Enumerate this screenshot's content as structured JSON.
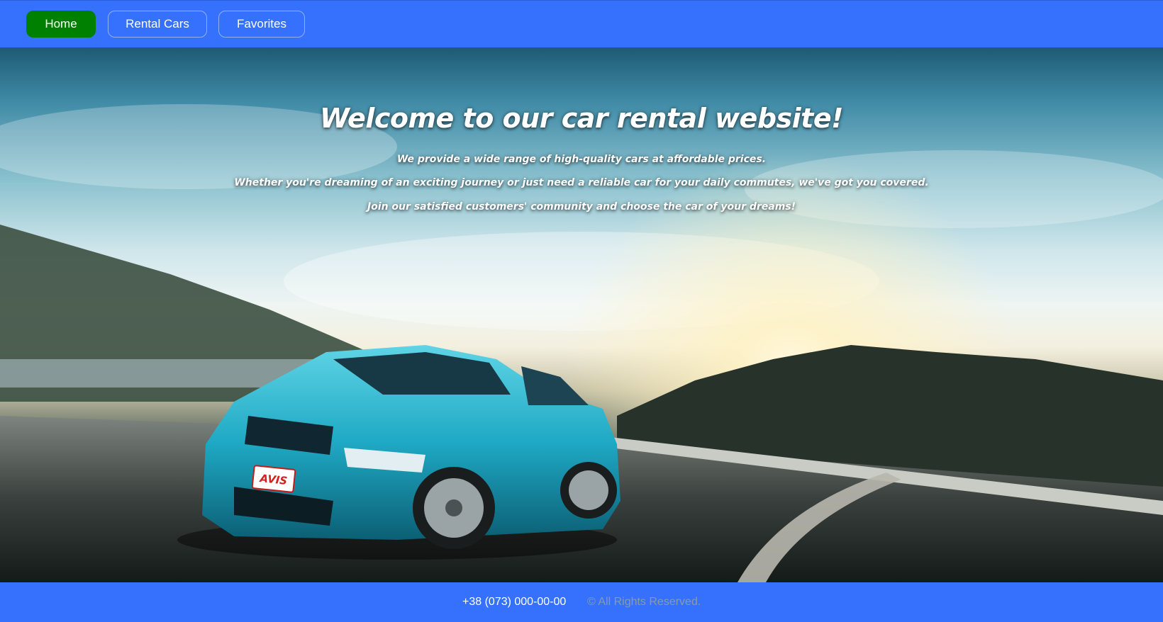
{
  "nav": {
    "items": [
      {
        "label": "Home",
        "active": true
      },
      {
        "label": "Rental Cars",
        "active": false
      },
      {
        "label": "Favorites",
        "active": false
      }
    ]
  },
  "hero": {
    "title": "Welcome to our car rental website!",
    "lines": [
      "We provide a wide range of high-quality cars at affordable prices.",
      "Whether you're dreaming of an exciting journey or just need a reliable car for your daily commutes, we've got you covered.",
      "Join our satisfied customers' community and choose the car of your dreams!"
    ],
    "plate_text": "AVIS"
  },
  "footer": {
    "phone": "+38 (073) 000-00-00",
    "copyright": "© All Rights Reserved."
  },
  "colors": {
    "bar": "#3671fe",
    "active_button": "#008000",
    "car": "#1fa9c4"
  }
}
